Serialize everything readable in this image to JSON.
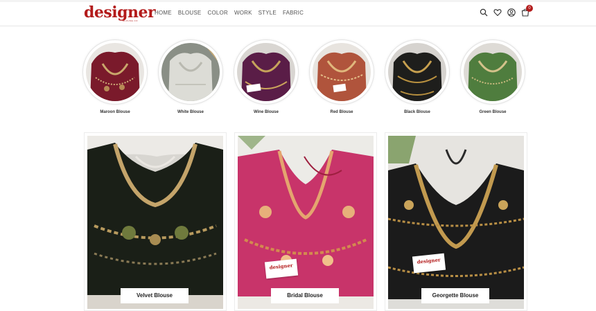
{
  "brand": {
    "name": "designer",
    "sub": "BLOUSE.CO",
    "color": "#b31b1b"
  },
  "nav": {
    "items": [
      "HOME",
      "BLOUSE",
      "COLOR",
      "WORK",
      "STYLE",
      "FABRIC"
    ]
  },
  "header_icons": [
    "search-icon",
    "heart-icon",
    "user-icon",
    "cart-icon"
  ],
  "cart": {
    "count": "0"
  },
  "categories": [
    {
      "label": "Maroon Blouse",
      "color": "#7a1a2b"
    },
    {
      "label": "White Blouse",
      "color": "#cfcfc8"
    },
    {
      "label": "Wine Blouse",
      "color": "#5a1d47"
    },
    {
      "label": "Red Blouse",
      "color": "#b0543c"
    },
    {
      "label": "Black Blouse",
      "color": "#1e1e1c"
    },
    {
      "label": "Green Blouse",
      "color": "#4f7d3e"
    }
  ],
  "products": [
    {
      "label": "Velvet Blouse",
      "color": "#1a1f17"
    },
    {
      "label": "Bridal Blouse",
      "color": "#c8346a"
    },
    {
      "label": "Georgette Blouse",
      "color": "#1b1b1b"
    }
  ],
  "tag_text": "designer"
}
